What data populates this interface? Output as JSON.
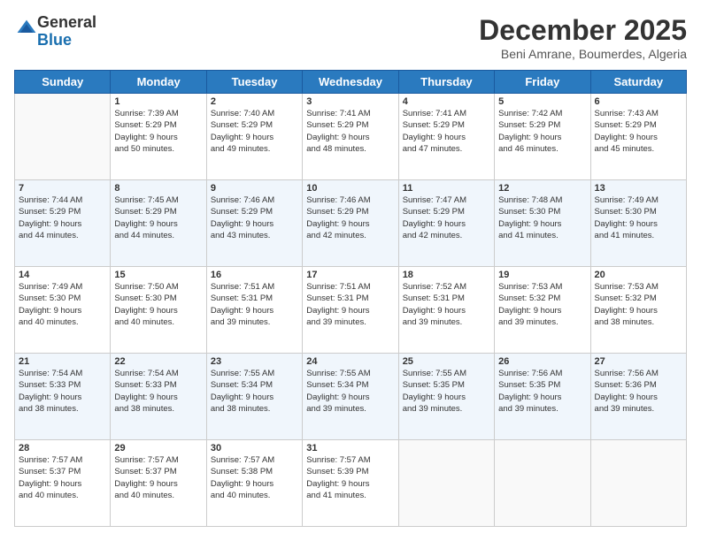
{
  "logo": {
    "line1": "General",
    "line2": "Blue"
  },
  "header": {
    "month": "December 2025",
    "location": "Beni Amrane, Boumerdes, Algeria"
  },
  "weekdays": [
    "Sunday",
    "Monday",
    "Tuesday",
    "Wednesday",
    "Thursday",
    "Friday",
    "Saturday"
  ],
  "weeks": [
    [
      {
        "day": "",
        "info": ""
      },
      {
        "day": "1",
        "info": "Sunrise: 7:39 AM\nSunset: 5:29 PM\nDaylight: 9 hours\nand 50 minutes."
      },
      {
        "day": "2",
        "info": "Sunrise: 7:40 AM\nSunset: 5:29 PM\nDaylight: 9 hours\nand 49 minutes."
      },
      {
        "day": "3",
        "info": "Sunrise: 7:41 AM\nSunset: 5:29 PM\nDaylight: 9 hours\nand 48 minutes."
      },
      {
        "day": "4",
        "info": "Sunrise: 7:41 AM\nSunset: 5:29 PM\nDaylight: 9 hours\nand 47 minutes."
      },
      {
        "day": "5",
        "info": "Sunrise: 7:42 AM\nSunset: 5:29 PM\nDaylight: 9 hours\nand 46 minutes."
      },
      {
        "day": "6",
        "info": "Sunrise: 7:43 AM\nSunset: 5:29 PM\nDaylight: 9 hours\nand 45 minutes."
      }
    ],
    [
      {
        "day": "7",
        "info": "Sunrise: 7:44 AM\nSunset: 5:29 PM\nDaylight: 9 hours\nand 44 minutes."
      },
      {
        "day": "8",
        "info": "Sunrise: 7:45 AM\nSunset: 5:29 PM\nDaylight: 9 hours\nand 44 minutes."
      },
      {
        "day": "9",
        "info": "Sunrise: 7:46 AM\nSunset: 5:29 PM\nDaylight: 9 hours\nand 43 minutes."
      },
      {
        "day": "10",
        "info": "Sunrise: 7:46 AM\nSunset: 5:29 PM\nDaylight: 9 hours\nand 42 minutes."
      },
      {
        "day": "11",
        "info": "Sunrise: 7:47 AM\nSunset: 5:29 PM\nDaylight: 9 hours\nand 42 minutes."
      },
      {
        "day": "12",
        "info": "Sunrise: 7:48 AM\nSunset: 5:30 PM\nDaylight: 9 hours\nand 41 minutes."
      },
      {
        "day": "13",
        "info": "Sunrise: 7:49 AM\nSunset: 5:30 PM\nDaylight: 9 hours\nand 41 minutes."
      }
    ],
    [
      {
        "day": "14",
        "info": "Sunrise: 7:49 AM\nSunset: 5:30 PM\nDaylight: 9 hours\nand 40 minutes."
      },
      {
        "day": "15",
        "info": "Sunrise: 7:50 AM\nSunset: 5:30 PM\nDaylight: 9 hours\nand 40 minutes."
      },
      {
        "day": "16",
        "info": "Sunrise: 7:51 AM\nSunset: 5:31 PM\nDaylight: 9 hours\nand 39 minutes."
      },
      {
        "day": "17",
        "info": "Sunrise: 7:51 AM\nSunset: 5:31 PM\nDaylight: 9 hours\nand 39 minutes."
      },
      {
        "day": "18",
        "info": "Sunrise: 7:52 AM\nSunset: 5:31 PM\nDaylight: 9 hours\nand 39 minutes."
      },
      {
        "day": "19",
        "info": "Sunrise: 7:53 AM\nSunset: 5:32 PM\nDaylight: 9 hours\nand 39 minutes."
      },
      {
        "day": "20",
        "info": "Sunrise: 7:53 AM\nSunset: 5:32 PM\nDaylight: 9 hours\nand 38 minutes."
      }
    ],
    [
      {
        "day": "21",
        "info": "Sunrise: 7:54 AM\nSunset: 5:33 PM\nDaylight: 9 hours\nand 38 minutes."
      },
      {
        "day": "22",
        "info": "Sunrise: 7:54 AM\nSunset: 5:33 PM\nDaylight: 9 hours\nand 38 minutes."
      },
      {
        "day": "23",
        "info": "Sunrise: 7:55 AM\nSunset: 5:34 PM\nDaylight: 9 hours\nand 38 minutes."
      },
      {
        "day": "24",
        "info": "Sunrise: 7:55 AM\nSunset: 5:34 PM\nDaylight: 9 hours\nand 39 minutes."
      },
      {
        "day": "25",
        "info": "Sunrise: 7:55 AM\nSunset: 5:35 PM\nDaylight: 9 hours\nand 39 minutes."
      },
      {
        "day": "26",
        "info": "Sunrise: 7:56 AM\nSunset: 5:35 PM\nDaylight: 9 hours\nand 39 minutes."
      },
      {
        "day": "27",
        "info": "Sunrise: 7:56 AM\nSunset: 5:36 PM\nDaylight: 9 hours\nand 39 minutes."
      }
    ],
    [
      {
        "day": "28",
        "info": "Sunrise: 7:57 AM\nSunset: 5:37 PM\nDaylight: 9 hours\nand 40 minutes."
      },
      {
        "day": "29",
        "info": "Sunrise: 7:57 AM\nSunset: 5:37 PM\nDaylight: 9 hours\nand 40 minutes."
      },
      {
        "day": "30",
        "info": "Sunrise: 7:57 AM\nSunset: 5:38 PM\nDaylight: 9 hours\nand 40 minutes."
      },
      {
        "day": "31",
        "info": "Sunrise: 7:57 AM\nSunset: 5:39 PM\nDaylight: 9 hours\nand 41 minutes."
      },
      {
        "day": "",
        "info": ""
      },
      {
        "day": "",
        "info": ""
      },
      {
        "day": "",
        "info": ""
      }
    ]
  ]
}
